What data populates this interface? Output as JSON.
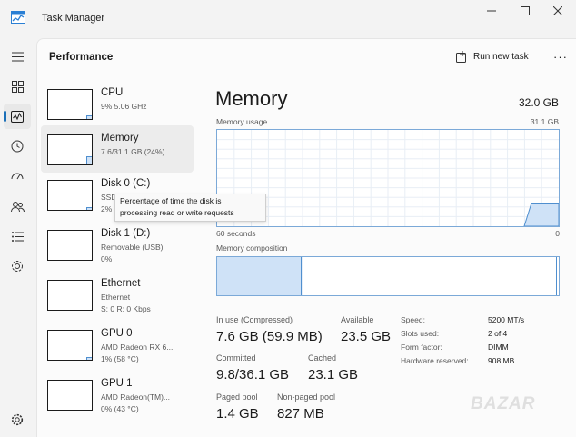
{
  "window": {
    "title": "Task Manager",
    "colors": {
      "accent": "#1a6fb8",
      "graph_fill": "#cfe2f7",
      "graph_line": "#7ba9d8"
    }
  },
  "nav": {
    "items": [
      {
        "icon": "hamburger-icon"
      },
      {
        "icon": "processes-icon"
      },
      {
        "icon": "performance-icon",
        "active": true
      },
      {
        "icon": "history-icon"
      },
      {
        "icon": "startup-icon"
      },
      {
        "icon": "users-icon"
      },
      {
        "icon": "details-icon"
      },
      {
        "icon": "services-icon"
      },
      {
        "icon": "settings-icon"
      }
    ]
  },
  "header": {
    "title": "Performance",
    "run_task": "Run new task",
    "more": "···"
  },
  "resources": [
    {
      "name": "CPU",
      "line1": "9%  5.06 GHz",
      "line2": "",
      "usage": 0.09
    },
    {
      "name": "Memory",
      "line1": "7.6/31.1 GB (24%)",
      "line2": "",
      "usage": 0.24,
      "selected": true
    },
    {
      "name": "Disk 0 (C:)",
      "line1": "SSD",
      "line2": "2%",
      "usage": 0.02
    },
    {
      "name": "Disk 1 (D:)",
      "line1": "Removable (USB)",
      "line2": "0%",
      "usage": 0
    },
    {
      "name": "Ethernet",
      "line1": "Ethernet",
      "line2": "S: 0  R: 0 Kbps",
      "usage": 0
    },
    {
      "name": "GPU 0",
      "line1": "AMD Radeon RX 6...",
      "line2": "1% (58 °C)",
      "usage": 0.01
    },
    {
      "name": "GPU 1",
      "line1": "AMD Radeon(TM)...",
      "line2": "0% (43 °C)",
      "usage": 0
    }
  ],
  "tooltip": {
    "line1": "Percentage of time the disk is",
    "line2": "processing read or write requests"
  },
  "detail": {
    "title": "Memory",
    "total": "32.0 GB",
    "usage_label": "Memory usage",
    "usage_max": "31.1 GB",
    "time_left": "60 seconds",
    "time_right": "0",
    "composition_label": "Memory composition",
    "usage_fraction": 0.24,
    "composition": {
      "in_use": 0.245,
      "modified": 0.002,
      "standby": 0.74,
      "free": 0.013
    },
    "stats": [
      {
        "label": "In use (Compressed)",
        "value": "7.6 GB (59.9 MB)"
      },
      {
        "label": "Available",
        "value": "23.5 GB"
      },
      {
        "label": "Committed",
        "value": "9.8/36.1 GB"
      },
      {
        "label": "Cached",
        "value": "23.1 GB"
      },
      {
        "label": "Paged pool",
        "value": "1.4 GB"
      },
      {
        "label": "Non-paged pool",
        "value": "827 MB"
      }
    ],
    "specs": [
      {
        "key": "Speed:",
        "value": "5200 MT/s"
      },
      {
        "key": "Slots used:",
        "value": "2 of 4"
      },
      {
        "key": "Form factor:",
        "value": "DIMM"
      },
      {
        "key": "Hardware reserved:",
        "value": "908 MB"
      }
    ]
  },
  "watermark": "BAZAR"
}
